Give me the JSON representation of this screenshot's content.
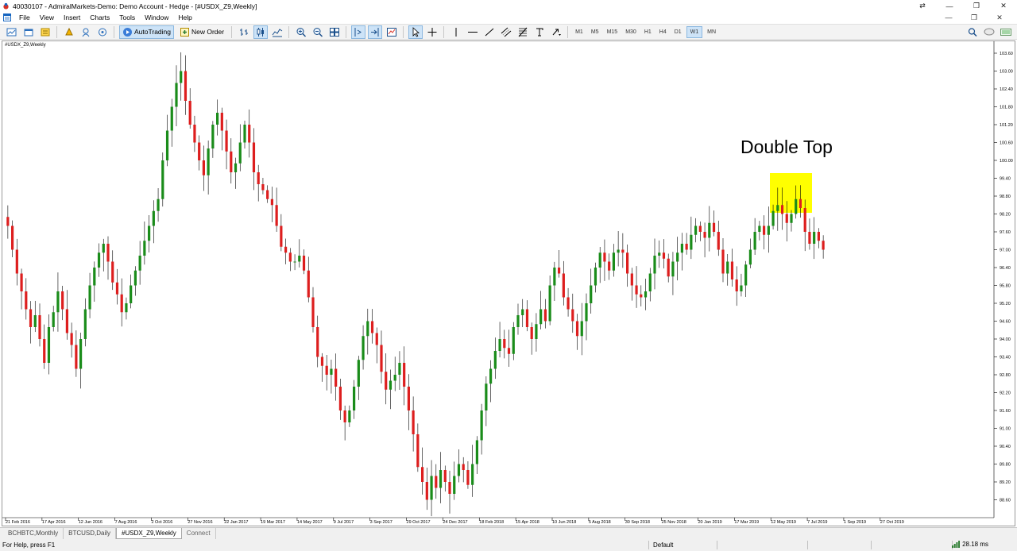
{
  "window": {
    "title": "40030107 - AdmiralMarkets-Demo: Demo Account - Hedge - [#USDX_Z9,Weekly]",
    "minimize": "—",
    "restore": "❐",
    "close": "✕",
    "extra": "⇄"
  },
  "menu": {
    "items": [
      "File",
      "View",
      "Insert",
      "Charts",
      "Tools",
      "Window",
      "Help"
    ],
    "doc_min": "—",
    "doc_restore": "❐",
    "doc_close": "✕"
  },
  "toolbar": {
    "autotrading_label": "AutoTrading",
    "neworder_label": "New Order",
    "timeframes": [
      "M1",
      "M5",
      "M15",
      "M30",
      "H1",
      "H4",
      "D1",
      "W1",
      "MN"
    ],
    "active_timeframe": "W1"
  },
  "chart": {
    "symbol_label": "#USDX_Z9,Weekly",
    "annotation_text": "Double Top",
    "highlight_color": "#ffff00",
    "bull_color": "#1a8c1a",
    "bear_color": "#dd1e1e",
    "y_labels": [
      "103.60",
      "103.00",
      "102.40",
      "101.80",
      "101.20",
      "100.60",
      "100.00",
      "99.40",
      "98.80",
      "98.20",
      "97.60",
      "97.00",
      "96.40",
      "95.80",
      "95.20",
      "94.60",
      "94.00",
      "93.40",
      "92.80",
      "92.20",
      "91.60",
      "91.00",
      "90.40",
      "89.80",
      "89.20",
      "88.60"
    ],
    "x_labels": [
      "21 Feb 2016",
      "17 Apr 2016",
      "12 Jun 2016",
      "7 Aug 2016",
      "2 Oct 2016",
      "27 Nov 2016",
      "22 Jan 2017",
      "19 Mar 2017",
      "14 May 2017",
      "9 Jul 2017",
      "3 Sep 2017",
      "29 Oct 2017",
      "24 Dec 2017",
      "18 Feb 2018",
      "15 Apr 2018",
      "10 Jun 2018",
      "5 Aug 2018",
      "30 Sep 2018",
      "25 Nov 2018",
      "20 Jan 2019",
      "17 Mar 2019",
      "12 May 2019",
      "7 Jul 2019",
      "1 Sep 2019",
      "27 Oct 2019"
    ]
  },
  "chart_data": {
    "type": "candlestick",
    "ylim": [
      88.0,
      104.0
    ],
    "closes": [
      97.8,
      97.0,
      96.2,
      95.6,
      95.0,
      94.4,
      94.8,
      94.0,
      93.2,
      94.4,
      94.9,
      95.6,
      95.0,
      94.2,
      93.8,
      93.0,
      94.0,
      95.0,
      95.8,
      96.4,
      96.9,
      97.2,
      96.6,
      95.9,
      95.5,
      94.9,
      95.2,
      95.8,
      96.3,
      96.8,
      97.3,
      97.8,
      98.3,
      98.7,
      100.0,
      101.0,
      101.8,
      102.6,
      103.0,
      102.0,
      101.2,
      100.6,
      100.0,
      99.5,
      100.4,
      101.2,
      101.6,
      101.0,
      100.3,
      99.6,
      99.9,
      100.6,
      101.2,
      100.6,
      99.6,
      99.2,
      99.0,
      98.7,
      98.5,
      97.8,
      97.1,
      96.9,
      96.6,
      96.6,
      96.8,
      96.3,
      95.4,
      94.4,
      93.4,
      93.1,
      92.8,
      93.0,
      92.4,
      91.6,
      91.2,
      91.6,
      92.4,
      93.3,
      94.1,
      94.6,
      94.2,
      93.8,
      92.9,
      92.3,
      92.6,
      92.8,
      93.2,
      92.4,
      91.6,
      90.8,
      89.7,
      89.2,
      88.6,
      89.4,
      89.0,
      89.6,
      89.2,
      88.8,
      89.4,
      89.8,
      89.6,
      89.1,
      89.8,
      90.6,
      91.6,
      92.5,
      93.0,
      93.6,
      94.0,
      93.7,
      93.5,
      94.4,
      94.8,
      95.0,
      94.4,
      94.0,
      94.5,
      95.0,
      94.6,
      95.8,
      96.4,
      96.2,
      95.4,
      95.0,
      94.6,
      94.1,
      94.6,
      95.2,
      95.8,
      96.4,
      96.9,
      96.6,
      96.3,
      96.9,
      97.0,
      96.9,
      96.2,
      95.8,
      95.5,
      95.4,
      95.6,
      96.2,
      96.8,
      96.9,
      96.7,
      96.1,
      96.6,
      96.9,
      97.2,
      97.0,
      97.5,
      97.8,
      97.6,
      97.4,
      97.9,
      97.6,
      97.0,
      96.2,
      96.6,
      96.0,
      95.6,
      95.8,
      96.5,
      97.0,
      97.6,
      97.8,
      97.5,
      97.8,
      98.3,
      98.5,
      98.2,
      97.9,
      98.2,
      98.7,
      98.4,
      97.6,
      97.2,
      97.6,
      97.3,
      97.0
    ]
  }
}
